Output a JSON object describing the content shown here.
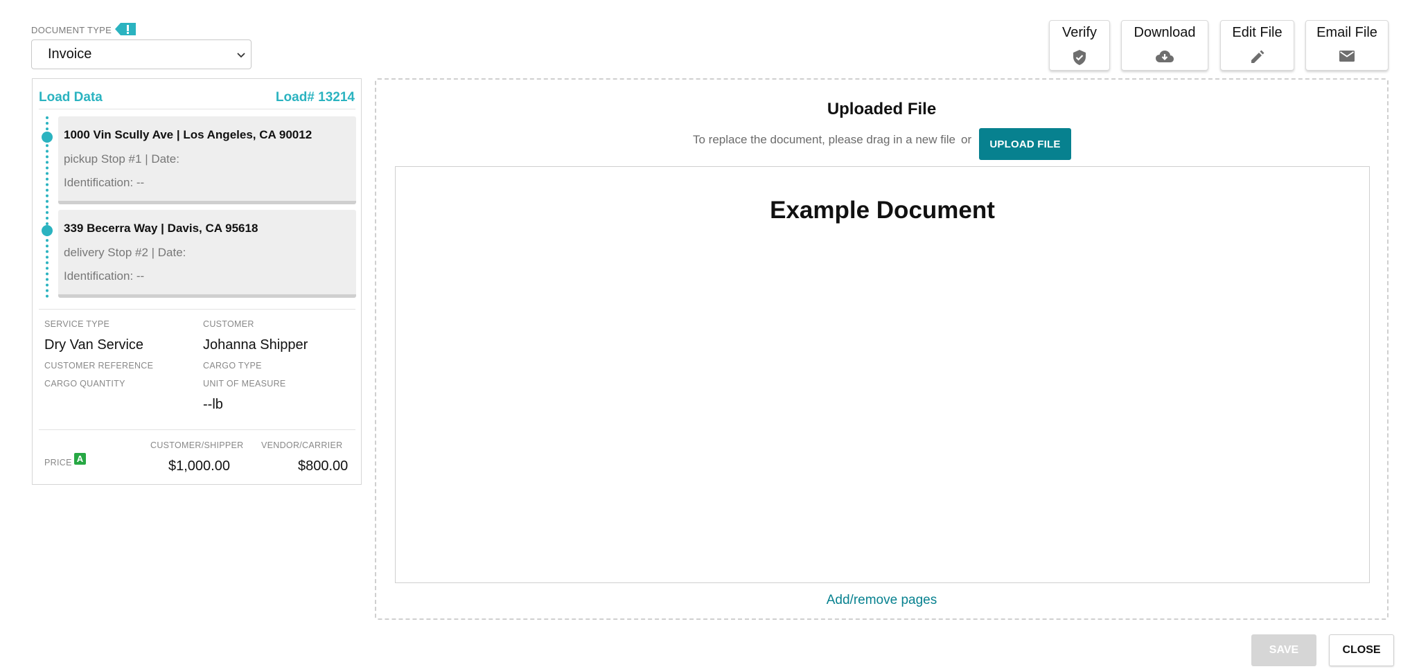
{
  "document_type": {
    "label": "DOCUMENT TYPE",
    "flag_icon": "exclamation-flag-icon",
    "selected": "Invoice"
  },
  "toolbar": {
    "verify_label": "Verify",
    "verify_icon": "shield-check-icon",
    "download_label": "Download",
    "download_icon": "cloud-download-icon",
    "edit_label": "Edit File",
    "edit_icon": "pencil-icon",
    "email_label": "Email File",
    "email_icon": "envelope-icon"
  },
  "load": {
    "header": "Load Data",
    "load_number": "Load# 13214",
    "stops": [
      {
        "address": "1000 Vin Scully Ave | Los Angeles, CA 90012",
        "detail": "pickup Stop #1 | Date:",
        "identification": "Identification: --"
      },
      {
        "address": "339 Becerra Way | Davis, CA 95618",
        "detail": "delivery Stop #2 | Date:",
        "identification": "Identification: --"
      }
    ],
    "fields": {
      "service_type_label": "SERVICE TYPE",
      "service_type": "Dry Van Service",
      "customer_label": "CUSTOMER",
      "customer": "Johanna Shipper",
      "customer_reference_label": "CUSTOMER REFERENCE",
      "cargo_type_label": "CARGO TYPE",
      "cargo_quantity_label": "CARGO QUANTITY",
      "unit_of_measure_label": "UNIT OF MEASURE",
      "unit_of_measure": "--lb"
    },
    "price": {
      "label": "PRICE",
      "badge": "A",
      "customer_label": "CUSTOMER/SHIPPER",
      "customer_value": "$1,000.00",
      "vendor_label": "VENDOR/CARRIER",
      "vendor_value": "$800.00"
    }
  },
  "upload": {
    "title": "Uploaded File",
    "hint": "To replace the document, please drag in a new file",
    "or": "or",
    "button": "UPLOAD FILE",
    "preview_title": "Example Document",
    "add_pages": "Add/remove pages"
  },
  "footer": {
    "save": "SAVE",
    "close": "CLOSE"
  },
  "colors": {
    "accent_teal": "#2bb3c0",
    "primary_button": "#07818f",
    "badge_green": "#27a844",
    "disabled": "#d6d6d6"
  }
}
